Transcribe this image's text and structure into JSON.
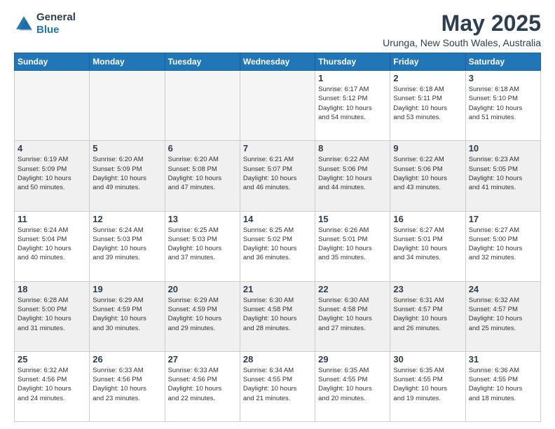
{
  "header": {
    "logo_general": "General",
    "logo_blue": "Blue",
    "month_year": "May 2025",
    "location": "Urunga, New South Wales, Australia"
  },
  "days_of_week": [
    "Sunday",
    "Monday",
    "Tuesday",
    "Wednesday",
    "Thursday",
    "Friday",
    "Saturday"
  ],
  "weeks": [
    [
      {
        "day": "",
        "info": ""
      },
      {
        "day": "",
        "info": ""
      },
      {
        "day": "",
        "info": ""
      },
      {
        "day": "",
        "info": ""
      },
      {
        "day": "1",
        "info": "Sunrise: 6:17 AM\nSunset: 5:12 PM\nDaylight: 10 hours\nand 54 minutes."
      },
      {
        "day": "2",
        "info": "Sunrise: 6:18 AM\nSunset: 5:11 PM\nDaylight: 10 hours\nand 53 minutes."
      },
      {
        "day": "3",
        "info": "Sunrise: 6:18 AM\nSunset: 5:10 PM\nDaylight: 10 hours\nand 51 minutes."
      }
    ],
    [
      {
        "day": "4",
        "info": "Sunrise: 6:19 AM\nSunset: 5:09 PM\nDaylight: 10 hours\nand 50 minutes."
      },
      {
        "day": "5",
        "info": "Sunrise: 6:20 AM\nSunset: 5:09 PM\nDaylight: 10 hours\nand 49 minutes."
      },
      {
        "day": "6",
        "info": "Sunrise: 6:20 AM\nSunset: 5:08 PM\nDaylight: 10 hours\nand 47 minutes."
      },
      {
        "day": "7",
        "info": "Sunrise: 6:21 AM\nSunset: 5:07 PM\nDaylight: 10 hours\nand 46 minutes."
      },
      {
        "day": "8",
        "info": "Sunrise: 6:22 AM\nSunset: 5:06 PM\nDaylight: 10 hours\nand 44 minutes."
      },
      {
        "day": "9",
        "info": "Sunrise: 6:22 AM\nSunset: 5:06 PM\nDaylight: 10 hours\nand 43 minutes."
      },
      {
        "day": "10",
        "info": "Sunrise: 6:23 AM\nSunset: 5:05 PM\nDaylight: 10 hours\nand 41 minutes."
      }
    ],
    [
      {
        "day": "11",
        "info": "Sunrise: 6:24 AM\nSunset: 5:04 PM\nDaylight: 10 hours\nand 40 minutes."
      },
      {
        "day": "12",
        "info": "Sunrise: 6:24 AM\nSunset: 5:03 PM\nDaylight: 10 hours\nand 39 minutes."
      },
      {
        "day": "13",
        "info": "Sunrise: 6:25 AM\nSunset: 5:03 PM\nDaylight: 10 hours\nand 37 minutes."
      },
      {
        "day": "14",
        "info": "Sunrise: 6:25 AM\nSunset: 5:02 PM\nDaylight: 10 hours\nand 36 minutes."
      },
      {
        "day": "15",
        "info": "Sunrise: 6:26 AM\nSunset: 5:01 PM\nDaylight: 10 hours\nand 35 minutes."
      },
      {
        "day": "16",
        "info": "Sunrise: 6:27 AM\nSunset: 5:01 PM\nDaylight: 10 hours\nand 34 minutes."
      },
      {
        "day": "17",
        "info": "Sunrise: 6:27 AM\nSunset: 5:00 PM\nDaylight: 10 hours\nand 32 minutes."
      }
    ],
    [
      {
        "day": "18",
        "info": "Sunrise: 6:28 AM\nSunset: 5:00 PM\nDaylight: 10 hours\nand 31 minutes."
      },
      {
        "day": "19",
        "info": "Sunrise: 6:29 AM\nSunset: 4:59 PM\nDaylight: 10 hours\nand 30 minutes."
      },
      {
        "day": "20",
        "info": "Sunrise: 6:29 AM\nSunset: 4:59 PM\nDaylight: 10 hours\nand 29 minutes."
      },
      {
        "day": "21",
        "info": "Sunrise: 6:30 AM\nSunset: 4:58 PM\nDaylight: 10 hours\nand 28 minutes."
      },
      {
        "day": "22",
        "info": "Sunrise: 6:30 AM\nSunset: 4:58 PM\nDaylight: 10 hours\nand 27 minutes."
      },
      {
        "day": "23",
        "info": "Sunrise: 6:31 AM\nSunset: 4:57 PM\nDaylight: 10 hours\nand 26 minutes."
      },
      {
        "day": "24",
        "info": "Sunrise: 6:32 AM\nSunset: 4:57 PM\nDaylight: 10 hours\nand 25 minutes."
      }
    ],
    [
      {
        "day": "25",
        "info": "Sunrise: 6:32 AM\nSunset: 4:56 PM\nDaylight: 10 hours\nand 24 minutes."
      },
      {
        "day": "26",
        "info": "Sunrise: 6:33 AM\nSunset: 4:56 PM\nDaylight: 10 hours\nand 23 minutes."
      },
      {
        "day": "27",
        "info": "Sunrise: 6:33 AM\nSunset: 4:56 PM\nDaylight: 10 hours\nand 22 minutes."
      },
      {
        "day": "28",
        "info": "Sunrise: 6:34 AM\nSunset: 4:55 PM\nDaylight: 10 hours\nand 21 minutes."
      },
      {
        "day": "29",
        "info": "Sunrise: 6:35 AM\nSunset: 4:55 PM\nDaylight: 10 hours\nand 20 minutes."
      },
      {
        "day": "30",
        "info": "Sunrise: 6:35 AM\nSunset: 4:55 PM\nDaylight: 10 hours\nand 19 minutes."
      },
      {
        "day": "31",
        "info": "Sunrise: 6:36 AM\nSunset: 4:55 PM\nDaylight: 10 hours\nand 18 minutes."
      }
    ]
  ]
}
